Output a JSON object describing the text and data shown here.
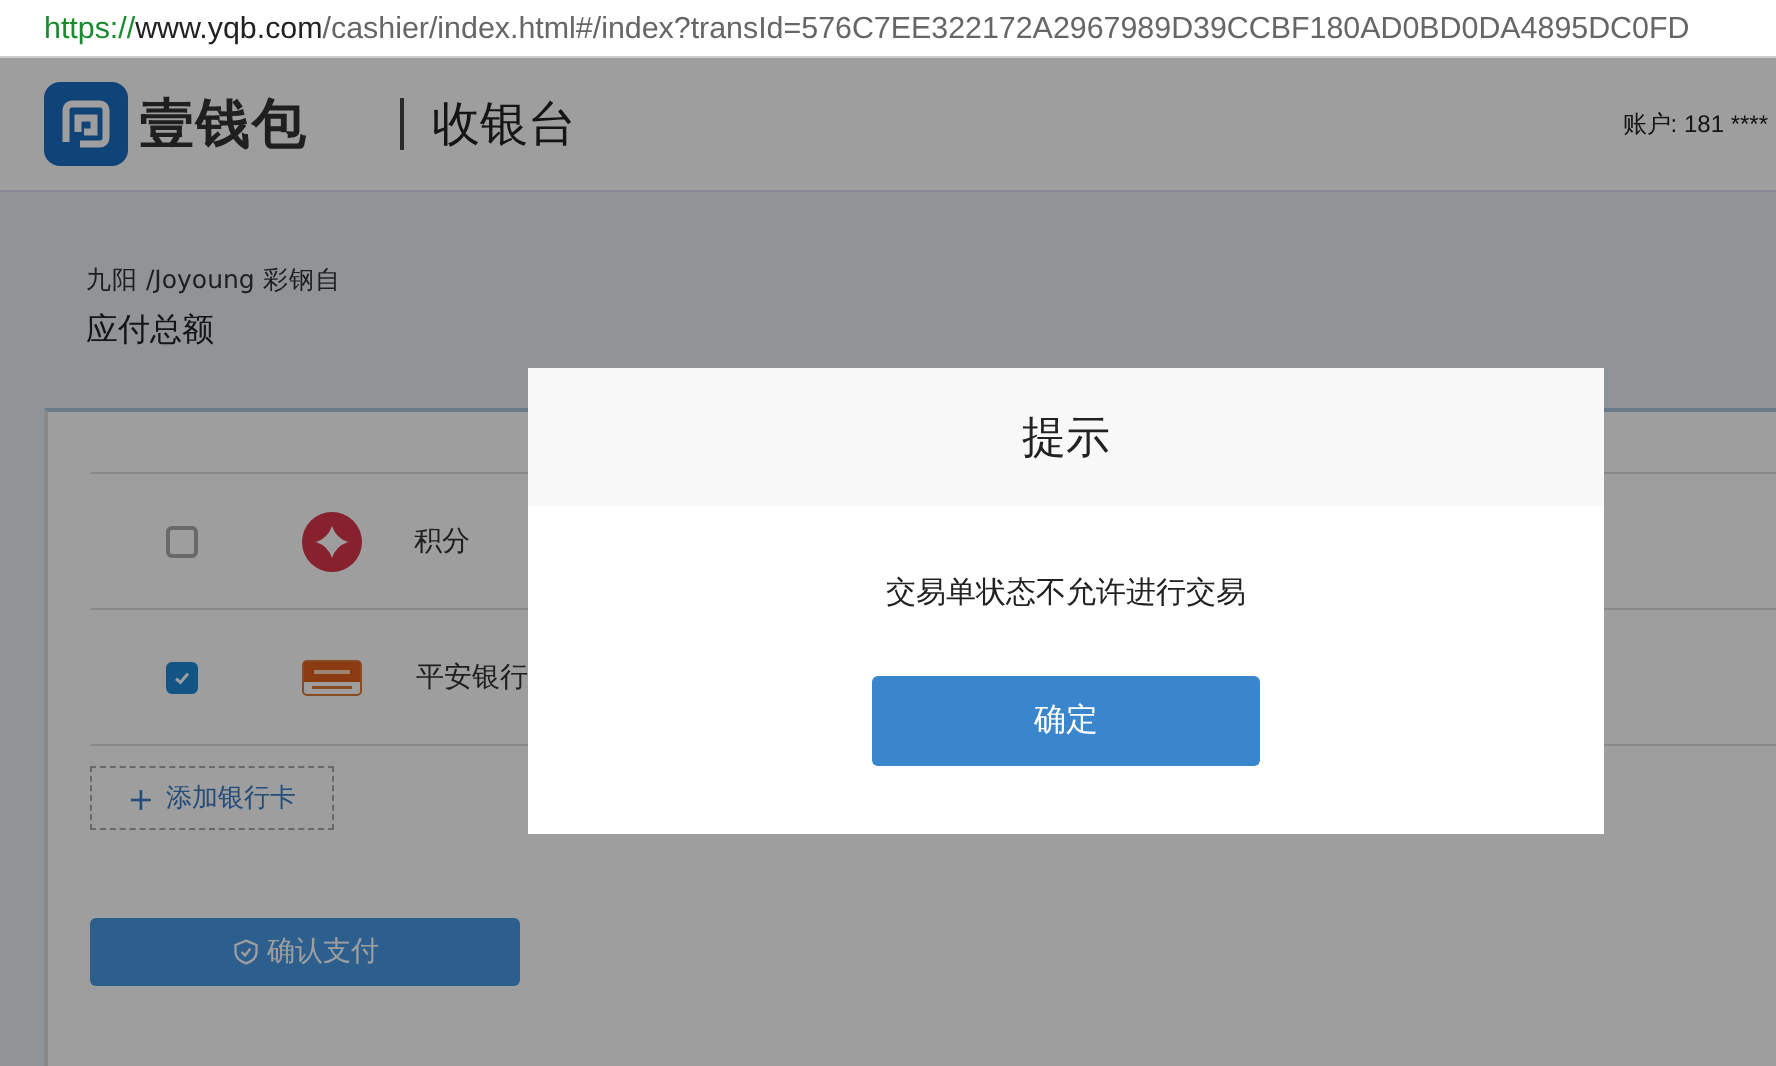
{
  "browser": {
    "scheme": "https://",
    "host": "www.yqb.com",
    "path": "/cashier/index.html#/index?transId=576C7EE322172A2967989D39CCBF180AD0BD0DA4895DC0FD"
  },
  "header": {
    "logo_text": "壹钱包",
    "title": "收银台",
    "account": "账户: 181 ****"
  },
  "order": {
    "product": "九阳 /Joyoung 彩钢自",
    "amount_label": "应付总额"
  },
  "payments": [
    {
      "kind": "points",
      "name": "积分",
      "checked": false
    },
    {
      "kind": "bank",
      "name": "平安银行",
      "checked": true
    }
  ],
  "add_card": {
    "icon": "+",
    "label": "添加银行卡"
  },
  "confirm_button": "确认支付",
  "dialog": {
    "title": "提示",
    "message": "交易单状态不允许进行交易",
    "button": "确定"
  }
}
